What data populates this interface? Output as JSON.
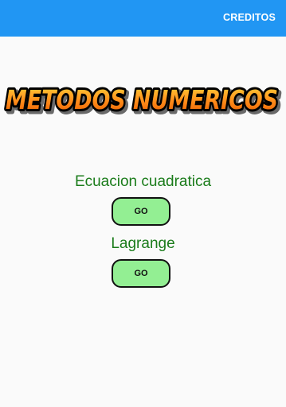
{
  "appbar": {
    "action_label": "CREDITOS",
    "color": "#2196f3"
  },
  "logo": {
    "text": "METODOS NUMERICOS",
    "fill_color": "#ff8c1a",
    "outline_color": "#000000"
  },
  "methods": [
    {
      "title": "Ecuacion cuadratica",
      "button_label": "GO"
    },
    {
      "title": "Lagrange",
      "button_label": "GO"
    }
  ],
  "colors": {
    "title_text": "#1b7c1b",
    "button_fill": "#93ef93"
  }
}
